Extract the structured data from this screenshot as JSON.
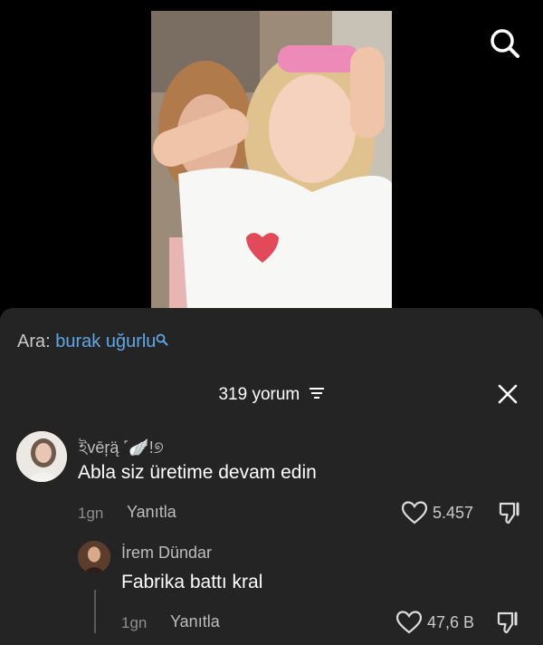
{
  "search": {
    "prefix": "Ara:",
    "query": "burak uğurlu"
  },
  "comments_header": {
    "count_label": "319 yorum"
  },
  "comments": [
    {
      "username": "ইvēŗą̈ ˹🪽!୭",
      "text": "Abla siz üretime devam edin",
      "time": "1gn",
      "reply_label": "Yanıtla",
      "likes": "5.457"
    },
    {
      "username": "İrem Dündar",
      "text": "Fabrika battı kral",
      "time": "1gn",
      "reply_label": "Yanıtla",
      "likes": "47,6 B"
    }
  ],
  "colors": {
    "panel": "#242424",
    "link": "#5fa8e8",
    "background": "#000000"
  }
}
